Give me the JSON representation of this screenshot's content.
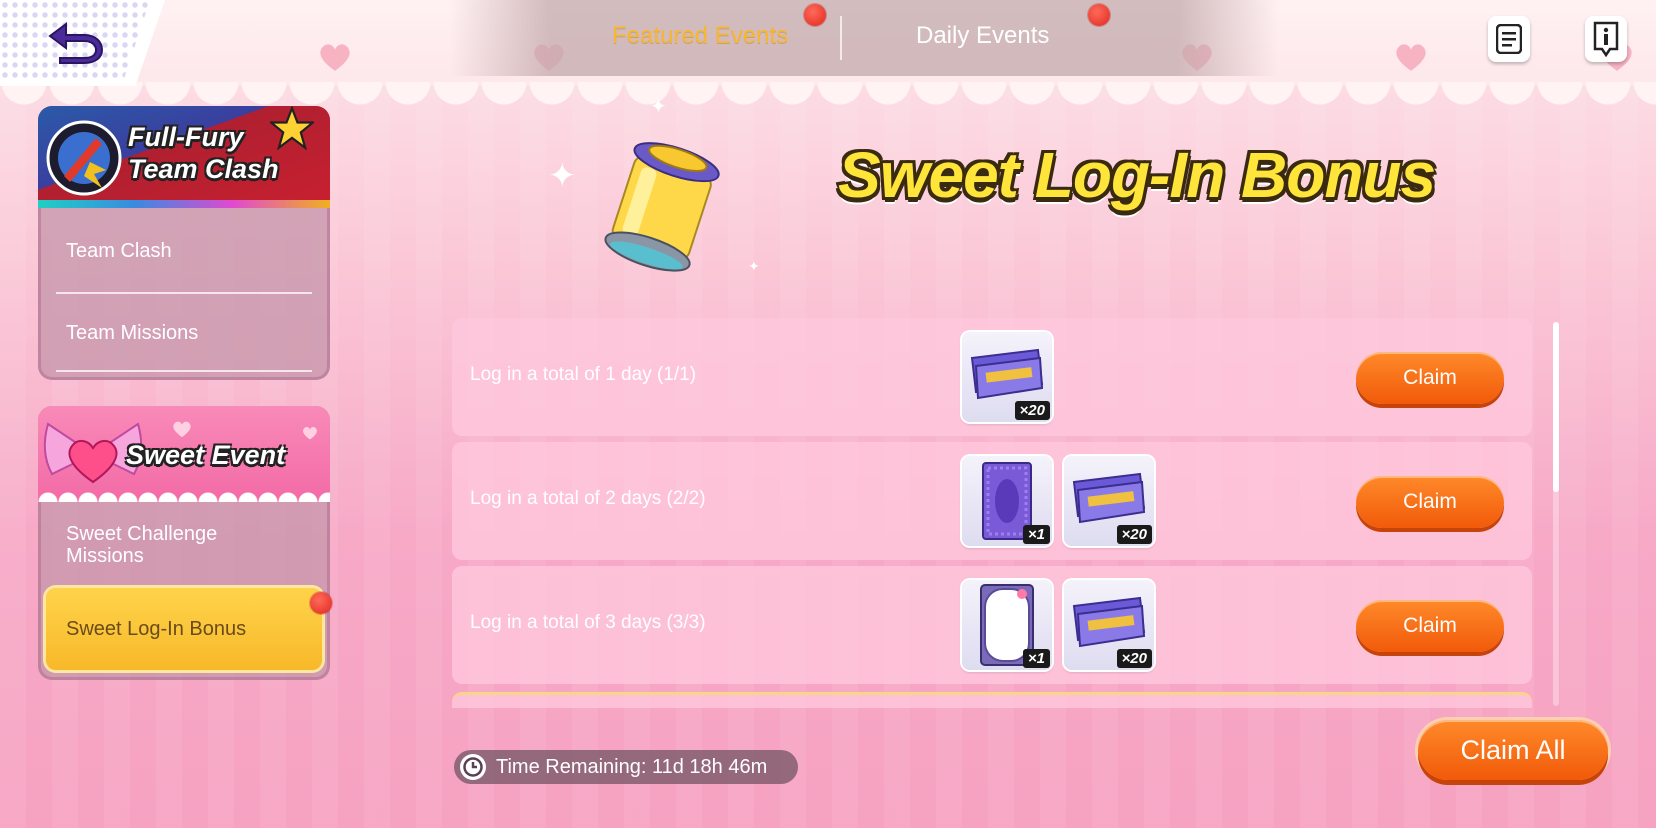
{
  "header": {
    "tabs": [
      {
        "label": "Featured Events",
        "active": true,
        "has_notification": true
      },
      {
        "label": "Daily Events",
        "active": false,
        "has_notification": true
      }
    ],
    "icons": [
      "back-arrow-icon",
      "list-icon",
      "info-icon"
    ]
  },
  "sidebar": {
    "events": [
      {
        "banner_title_line1": "Full-Fury",
        "banner_title_line2": "Team Clash",
        "items": [
          {
            "label": "Team Clash"
          },
          {
            "label": "Team Missions"
          }
        ]
      },
      {
        "banner_title": "Sweet Event",
        "items": [
          {
            "label": "Sweet Challenge Missions"
          },
          {
            "label": "Sweet Log-In Bonus",
            "selected": true,
            "has_notification": true
          }
        ]
      }
    ]
  },
  "main": {
    "title": "Sweet Log-In Bonus",
    "rows": [
      {
        "text": "Log in a total of 1 day (1/1)",
        "rewards": [
          {
            "icon": "ticket-icon",
            "qty": "×20"
          }
        ],
        "button": "Claim"
      },
      {
        "text": "Log in a total of 2 days (2/2)",
        "rewards": [
          {
            "icon": "card-back-icon",
            "qty": "×1"
          },
          {
            "icon": "ticket-icon",
            "qty": "×20"
          }
        ],
        "button": "Claim"
      },
      {
        "text": "Log in a total of 3 days (3/3)",
        "rewards": [
          {
            "icon": "frame-icon",
            "qty": "×1"
          },
          {
            "icon": "ticket-icon",
            "qty": "×20"
          }
        ],
        "button": "Claim"
      }
    ],
    "time_remaining": "Time Remaining: 11d 18h 46m",
    "claim_all": "Claim All"
  },
  "colors": {
    "accent_orange": "#f15a0a",
    "tab_active": "#f7b733",
    "selected_item": "#ffd34a",
    "title_yellow": "#ffe53a"
  }
}
